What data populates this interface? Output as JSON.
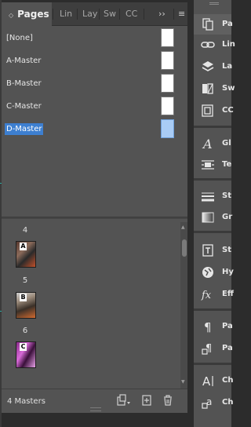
{
  "tabs": [
    {
      "label": "Pages",
      "active": true
    },
    {
      "label": "Lin"
    },
    {
      "label": "Lay"
    },
    {
      "label": "Sw"
    },
    {
      "label": "CC"
    }
  ],
  "tab_controls": {
    "overflow": "››",
    "menu": "≡"
  },
  "masters": [
    {
      "label": "[None]"
    },
    {
      "label": "A-Master"
    },
    {
      "label": "B-Master"
    },
    {
      "label": "C-Master"
    },
    {
      "label": "D-Master",
      "selected": true
    }
  ],
  "pages": [
    {
      "number": "4",
      "master_prefix": "A"
    },
    {
      "number": "5",
      "master_prefix": "B"
    },
    {
      "number": "6",
      "master_prefix": "C"
    }
  ],
  "footer": {
    "status": "4 Masters"
  },
  "dock": [
    {
      "label": "Pa",
      "icon": "pages-icon",
      "active": true
    },
    {
      "label": "Lin",
      "icon": "links-icon"
    },
    {
      "label": "La",
      "icon": "layers-icon"
    },
    {
      "label": "Sw",
      "icon": "swatches-icon"
    },
    {
      "label": "CC",
      "icon": "cc-libraries-icon"
    },
    {
      "label": "Gl",
      "icon": "glyphs-icon"
    },
    {
      "label": "Te",
      "icon": "text-wrap-icon"
    },
    {
      "label": "St",
      "icon": "stroke-icon"
    },
    {
      "label": "Gr",
      "icon": "gradient-icon"
    },
    {
      "label": "St",
      "icon": "story-icon"
    },
    {
      "label": "Hy",
      "icon": "hyperlinks-icon"
    },
    {
      "label": "Eff",
      "icon": "effects-icon"
    },
    {
      "label": "Pa",
      "icon": "paragraph-icon"
    },
    {
      "label": "Pa",
      "icon": "paragraph-styles-icon"
    },
    {
      "label": "Ch",
      "icon": "character-icon"
    },
    {
      "label": "Ch",
      "icon": "character-styles-icon"
    }
  ],
  "colors": {
    "selection": "#3d7fd0",
    "panel": "#535353",
    "tabbar": "#3e3e3e"
  }
}
